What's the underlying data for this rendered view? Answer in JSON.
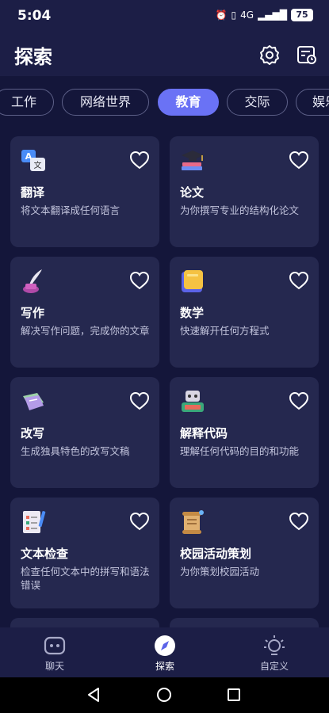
{
  "status": {
    "time": "5:04",
    "network": "4G",
    "battery": "75"
  },
  "header": {
    "title": "探索"
  },
  "tabs": [
    {
      "label": "工作",
      "active": false
    },
    {
      "label": "网络世界",
      "active": false
    },
    {
      "label": "教育",
      "active": true
    },
    {
      "label": "交际",
      "active": false
    },
    {
      "label": "娱乐",
      "active": false
    }
  ],
  "cards": [
    {
      "icon": "translate-icon",
      "title": "翻译",
      "desc": "将文本翻译成任何语言"
    },
    {
      "icon": "graduation-cap-icon",
      "title": "论文",
      "desc": "为你撰写专业的结构化论文"
    },
    {
      "icon": "quill-ink-icon",
      "title": "写作",
      "desc": "解决写作问题，完成你的文章"
    },
    {
      "icon": "math-notepad-icon",
      "title": "数学",
      "desc": "快速解开任何方程式"
    },
    {
      "icon": "rewrite-note-icon",
      "title": "改写",
      "desc": "生成独具特色的改写文稿"
    },
    {
      "icon": "code-robot-icon",
      "title": "解释代码",
      "desc": "理解任何代码的目的和功能"
    },
    {
      "icon": "checklist-icon",
      "title": "文本检查",
      "desc": "检查任何文本中的拼写和语法错误"
    },
    {
      "icon": "scroll-icon",
      "title": "校园活动策划",
      "desc": "为你策划校园活动"
    }
  ],
  "bottom_nav": [
    {
      "icon": "chat-bot-icon",
      "label": "聊天",
      "active": false
    },
    {
      "icon": "compass-icon",
      "label": "探索",
      "active": true
    },
    {
      "icon": "lightbulb-icon",
      "label": "自定义",
      "active": false
    }
  ],
  "colors": {
    "background": "#14163a",
    "header": "#1c1e46",
    "card": "#25284f",
    "accent": "#6a72f5"
  }
}
